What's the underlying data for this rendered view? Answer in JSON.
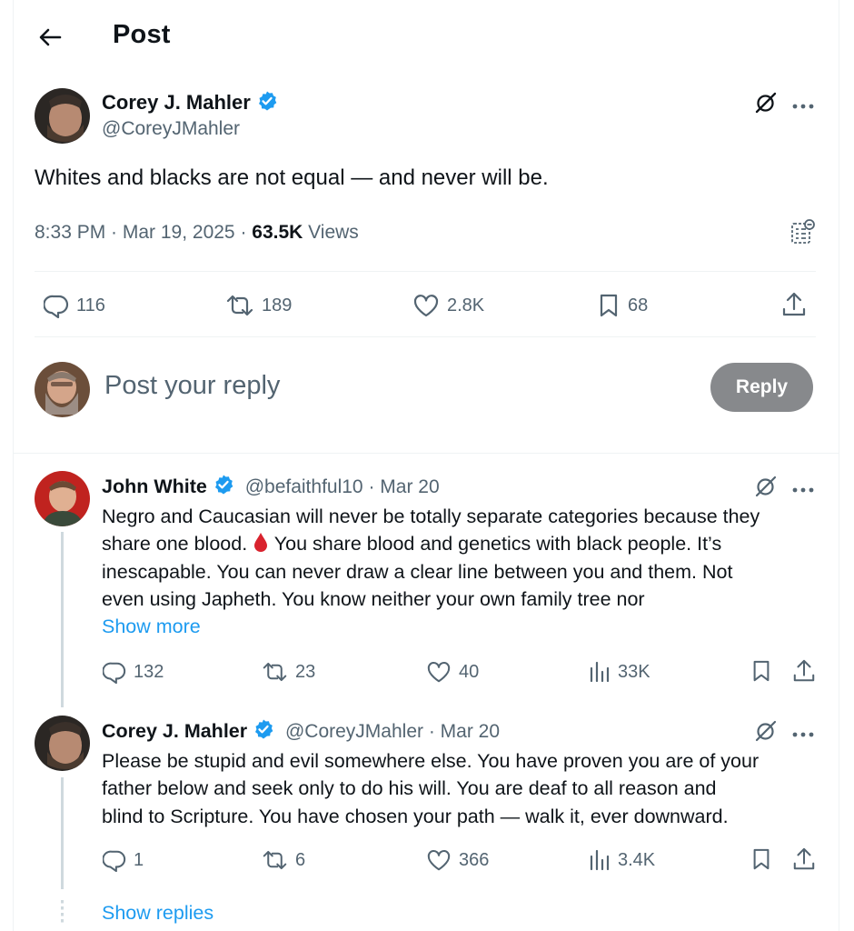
{
  "header": {
    "title": "Post"
  },
  "main_post": {
    "author_name": "Corey J. Mahler",
    "handle": "@CoreyJMahler",
    "text": "Whites and blacks are not equal — and never will be.",
    "time": "8:33 PM · Mar 19, 2025 · ",
    "views_count": "63.5K",
    "views_label": " Views",
    "replies": "116",
    "reposts": "189",
    "likes": "2.8K",
    "bookmarks": "68"
  },
  "composer": {
    "placeholder": "Post your reply",
    "reply_button": "Reply"
  },
  "replies": [
    {
      "author_name": "John White",
      "handle": "@befaithful10 · Mar 20",
      "text_line1": "Negro and Caucasian will never be totally separate categories because they",
      "text_line2a": "share one blood. ",
      "text_line2b": " You share blood and genetics with black people. It’s",
      "text_line3": "inescapable. You can never draw a clear line between you and them. Not",
      "text_line4": "even using Japheth. You know neither your own family tree nor",
      "show_more": "Show more",
      "replies": "132",
      "reposts": "23",
      "likes": "40",
      "views": "33K"
    },
    {
      "author_name": "Corey J. Mahler",
      "handle": "@CoreyJMahler · Mar 20",
      "text_line1": "Please be stupid and evil somewhere else. You have proven you are of your",
      "text_line2": "father below and seek only to do his will. You are deaf to all reason and",
      "text_line3": "blind to Scripture. You have chosen your path — walk it, ever downward.",
      "replies": "1",
      "reposts": "6",
      "likes": "366",
      "views": "3.4K"
    }
  ],
  "show_replies": "Show replies",
  "colors": {
    "accent": "#1d9bf0",
    "verified": "#1d9bf0",
    "secondary": "#536471",
    "reply_button": "#87898c"
  }
}
